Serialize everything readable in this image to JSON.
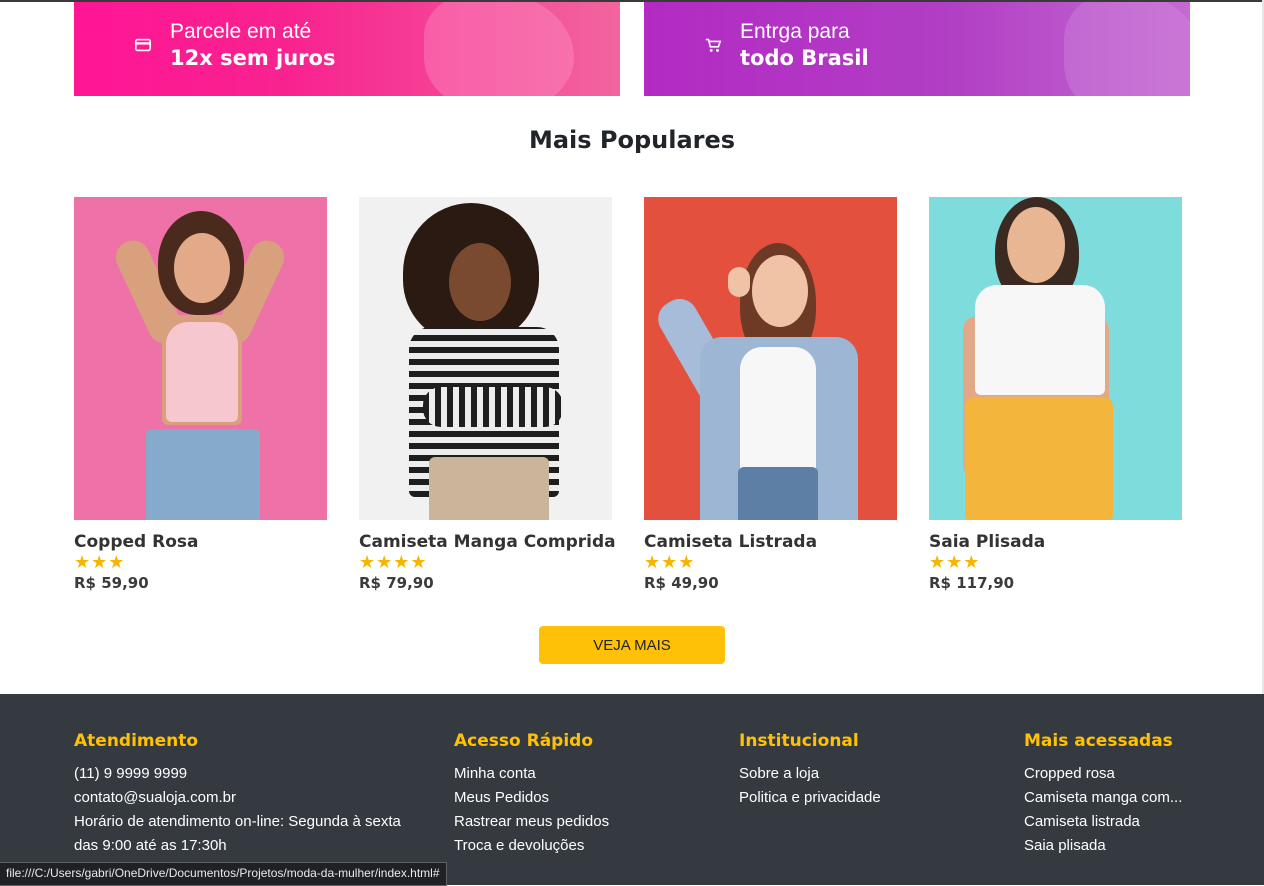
{
  "banners": [
    {
      "line1": "Parcele em até",
      "line2": "12x sem juros",
      "icon": "credit-card-icon"
    },
    {
      "line1": "Entrga para",
      "line2": "todo Brasil",
      "icon": "cart-icon"
    }
  ],
  "popular": {
    "title": "Mais Populares",
    "products": [
      {
        "name": "Copped Rosa",
        "rating": 3,
        "stars": "★★★",
        "price": "R$ 59,90"
      },
      {
        "name": "Camiseta Manga Comprida",
        "rating": 4,
        "stars": "★★★★",
        "price": "R$ 79,90"
      },
      {
        "name": "Camiseta Listrada",
        "rating": 3,
        "stars": "★★★",
        "price": "R$ 49,90"
      },
      {
        "name": "Saia Plisada",
        "rating": 3,
        "stars": "★★★",
        "price": "R$ 117,90"
      }
    ],
    "cta_label": "VEJA MAIS"
  },
  "footer": {
    "atendimento": {
      "title": "Atendimento",
      "phone": "(11) 9 9999 9999",
      "email": "contato@sualoja.com.br",
      "hours1": "Horário de atendimento on-line: Segunda à sexta",
      "hours2": "das 9:00 até as 17:30h"
    },
    "acesso": {
      "title": "Acesso Rápido",
      "links": [
        "Minha conta",
        "Meus Pedidos",
        "Rastrear meus pedidos",
        "Troca e devoluções"
      ]
    },
    "institucional": {
      "title": "Institucional",
      "links": [
        "Sobre a loja",
        "Politica e privacidade"
      ]
    },
    "acessadas": {
      "title": "Mais acessadas",
      "links": [
        "Cropped rosa",
        "Camiseta manga com...",
        "Camiseta listrada",
        "Saia plisada"
      ]
    }
  },
  "status_url": "file:///C:/Users/gabri/OneDrive/Documentos/Projetos/moda-da-mulher/index.html#",
  "colors": {
    "accent": "#ffc107",
    "footer_bg": "#343a40",
    "banner_pink": "#ff1595",
    "banner_purple": "#b32ac3",
    "star": "#f7b500"
  }
}
